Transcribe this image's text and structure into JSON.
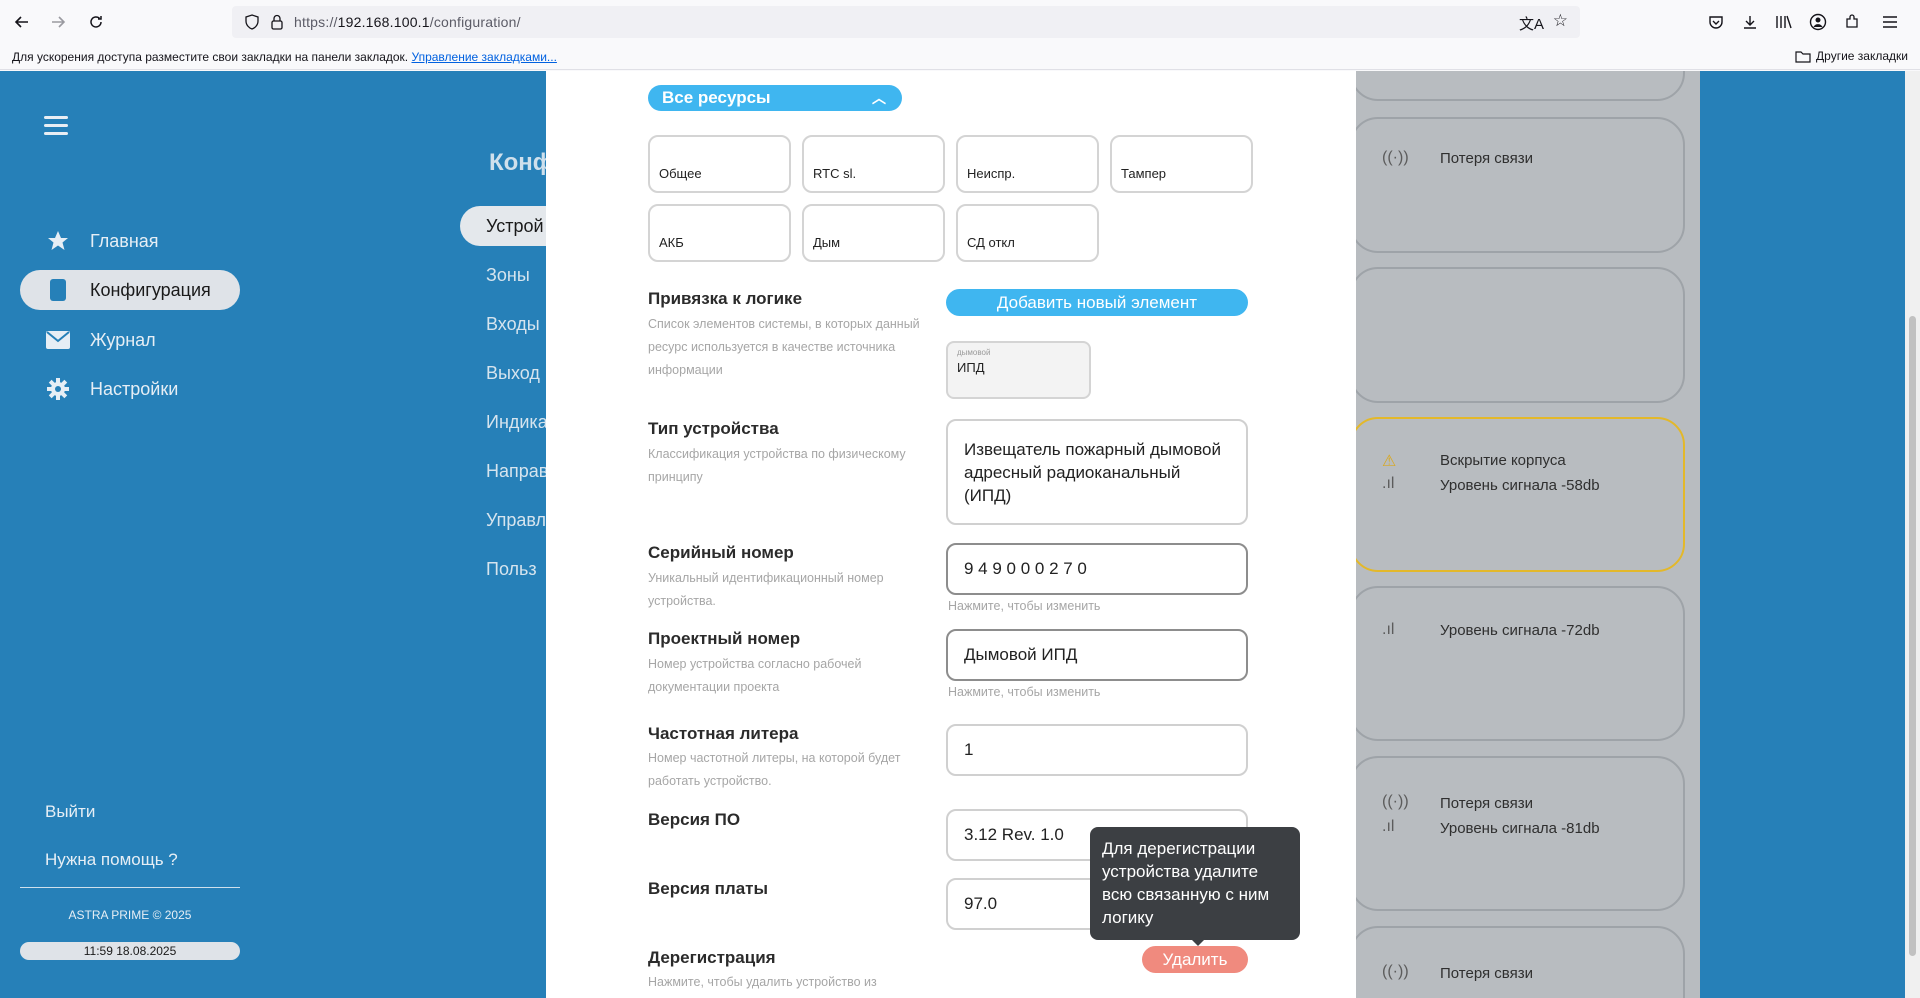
{
  "browser": {
    "url_prefix": "https://",
    "url_host": "192.168.100.1",
    "url_path": "/configuration/",
    "bookmarks_hint": "Для ускорения доступа разместите свои закладки на панели закладок.",
    "bookmarks_manage": "Управление закладками...",
    "other_bookmarks": "Другие закладки"
  },
  "sidebar": {
    "items": [
      {
        "label": "Главная",
        "icon": "star-icon"
      },
      {
        "label": "Конфигурация",
        "icon": "device-icon"
      },
      {
        "label": "Журнал",
        "icon": "mail-icon"
      },
      {
        "label": "Настройки",
        "icon": "gear-icon"
      }
    ],
    "logout": "Выйти",
    "help": "Нужна помощь ?",
    "copyright": "ASTRA PRIME © 2025",
    "clock": "11:59 18.08.2025"
  },
  "config": {
    "title": "Конф",
    "nav": [
      "Устрой",
      "Зоны",
      "Входы",
      "Выход",
      "Индика",
      "Направ",
      "Управл",
      "Польз"
    ]
  },
  "cards": [
    {
      "lines": [
        "Потеря связи"
      ]
    },
    {
      "lines": [
        "Вскрытие корпуса",
        "Уровень сигнала -58db"
      ]
    },
    {
      "lines": [
        "Уровень сигнала -72db"
      ]
    },
    {
      "lines": [
        "Потеря связи",
        "Уровень сигнала -81db"
      ]
    },
    {
      "lines": [
        "Потеря связи"
      ]
    }
  ],
  "modal": {
    "resources_label": "Все ресурсы",
    "resources": [
      "Общее",
      "RTC sl.",
      "Неиспр.",
      "Тампер",
      "АКБ",
      "Дым",
      "СД откл"
    ],
    "logic": {
      "title": "Привязка к логике",
      "desc": "Список элементов системы, в которых данный ресурс используется в качестве источника информации",
      "add_button": "Добавить новый элемент",
      "chip_small": "дымовой",
      "chip_main": "ИПД"
    },
    "device_type": {
      "title": "Тип устройства",
      "desc": "Классификация устройства по физическому принципу",
      "value": "Извещатель пожарный дымовой адресный радиоканальный (ИПД)"
    },
    "serial": {
      "title": "Серийный номер",
      "desc": "Уникальный идентификационный номер устройства.",
      "value": "9 4 9 0 0 0 2 7 0",
      "hint": "Нажмите, чтобы изменить"
    },
    "project": {
      "title": "Проектный номер",
      "desc": "Номер устройства согласно рабочей документации проекта",
      "value": "Дымовой ИПД",
      "hint": "Нажмите, чтобы изменить"
    },
    "freq": {
      "title": "Частотная литера",
      "desc": "Номер частотной литеры, на которой будет работать устройство.",
      "value": "1"
    },
    "firmware": {
      "title": "Версия ПО",
      "value": "3.12 Rev. 1.0"
    },
    "board": {
      "title": "Версия платы",
      "value": "97.0"
    },
    "dereg": {
      "title": "Дерегистрация",
      "desc": "Нажмите, чтобы удалить устройство из",
      "delete_button": "Удалить",
      "tooltip": "Для дерегистрации устройства удалите всю связанную с ним логику"
    }
  }
}
